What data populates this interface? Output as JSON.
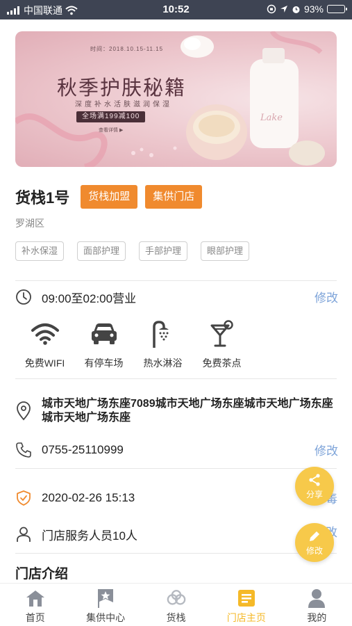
{
  "status_bar": {
    "carrier": "中国联通",
    "time": "10:52",
    "battery": "93%",
    "battery_level": 0.93
  },
  "banner": {
    "date": "时间：2018.10.15-11.15",
    "title": "秋季护肤秘籍",
    "subtitle": "深度补水活肤滋润保湿",
    "promo": "全场满199减100",
    "more": "查看详情 ▶",
    "bottle_label": "Lake"
  },
  "store": {
    "name": "货栈1号",
    "join_button": "货栈加盟",
    "supply_button": "集供门店",
    "district": "罗湖区",
    "tags": [
      "补水保湿",
      "面部护理",
      "手部护理",
      "眼部护理"
    ]
  },
  "hours": {
    "text": "09:00至02:00营业",
    "edit": "修改"
  },
  "amenities": [
    {
      "icon": "wifi-icon",
      "label": "免费WIFI"
    },
    {
      "icon": "car-icon",
      "label": "有停车场"
    },
    {
      "icon": "shower-icon",
      "label": "热水淋浴"
    },
    {
      "icon": "cocktail-icon",
      "label": "免费茶点"
    }
  ],
  "address": "城市天地广场东座7089城市天地广场东座城市天地广场东座城市天地广场东座",
  "phone": {
    "text": "0755-25110999",
    "edit": "修改"
  },
  "date_row": {
    "text": "2020-02-26  15:13",
    "partial_right": "毒"
  },
  "staff": {
    "text": "门店服务人员10人",
    "partial_right": "改"
  },
  "intro_title": "门店介绍",
  "fabs": {
    "share": "分享",
    "edit": "修改"
  },
  "colors": {
    "accent_orange": "#f08a2e",
    "fab_yellow": "#f7c94a",
    "link_blue": "#7ea4d9",
    "active_tab": "#f5b928",
    "status_bar": "#3e4453"
  },
  "tabbar": [
    {
      "icon": "home-icon",
      "label": "首页",
      "active": false
    },
    {
      "icon": "star-flag-icon",
      "label": "集供中心",
      "active": false
    },
    {
      "icon": "warehouse-icon",
      "label": "货栈",
      "active": false
    },
    {
      "icon": "store-list-icon",
      "label": "门店主页",
      "active": true
    },
    {
      "icon": "user-icon",
      "label": "我的",
      "active": false
    }
  ]
}
